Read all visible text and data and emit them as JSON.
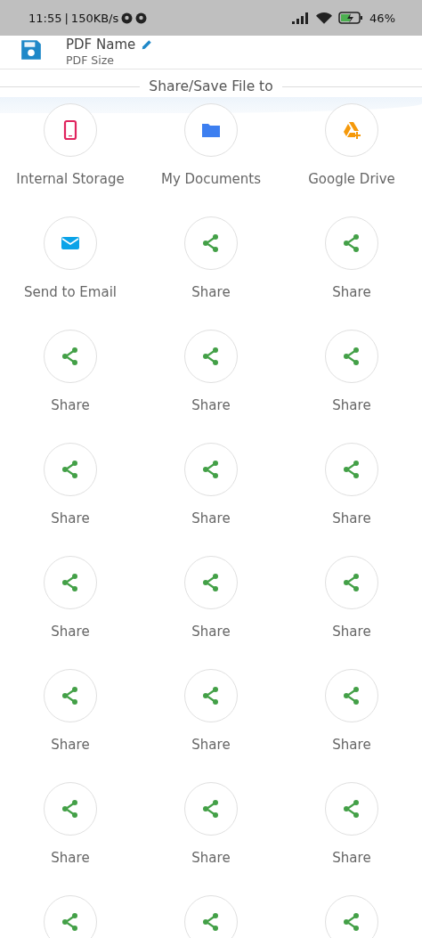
{
  "status_bar": {
    "time": "11:55",
    "separator": "|",
    "speed": "150KB/s",
    "battery": "46%"
  },
  "header": {
    "title": "PDF Name",
    "subtitle": "PDF Size"
  },
  "section_title": "Share/Save File to",
  "targets": [
    {
      "kind": "phone",
      "label": "Internal Storage"
    },
    {
      "kind": "folder",
      "label": "My Documents"
    },
    {
      "kind": "drive",
      "label": "Google Drive"
    },
    {
      "kind": "email",
      "label": "Send to Email"
    },
    {
      "kind": "share",
      "label": "Share"
    },
    {
      "kind": "share",
      "label": "Share"
    },
    {
      "kind": "share",
      "label": "Share"
    },
    {
      "kind": "share",
      "label": "Share"
    },
    {
      "kind": "share",
      "label": "Share"
    },
    {
      "kind": "share",
      "label": "Share"
    },
    {
      "kind": "share",
      "label": "Share"
    },
    {
      "kind": "share",
      "label": "Share"
    },
    {
      "kind": "share",
      "label": "Share"
    },
    {
      "kind": "share",
      "label": "Share"
    },
    {
      "kind": "share",
      "label": "Share"
    },
    {
      "kind": "share",
      "label": "Share"
    },
    {
      "kind": "share",
      "label": "Share"
    },
    {
      "kind": "share",
      "label": "Share"
    },
    {
      "kind": "share",
      "label": "Share"
    },
    {
      "kind": "share",
      "label": "Share"
    },
    {
      "kind": "share",
      "label": "Share"
    },
    {
      "kind": "share"
    },
    {
      "kind": "share"
    },
    {
      "kind": "share"
    }
  ]
}
